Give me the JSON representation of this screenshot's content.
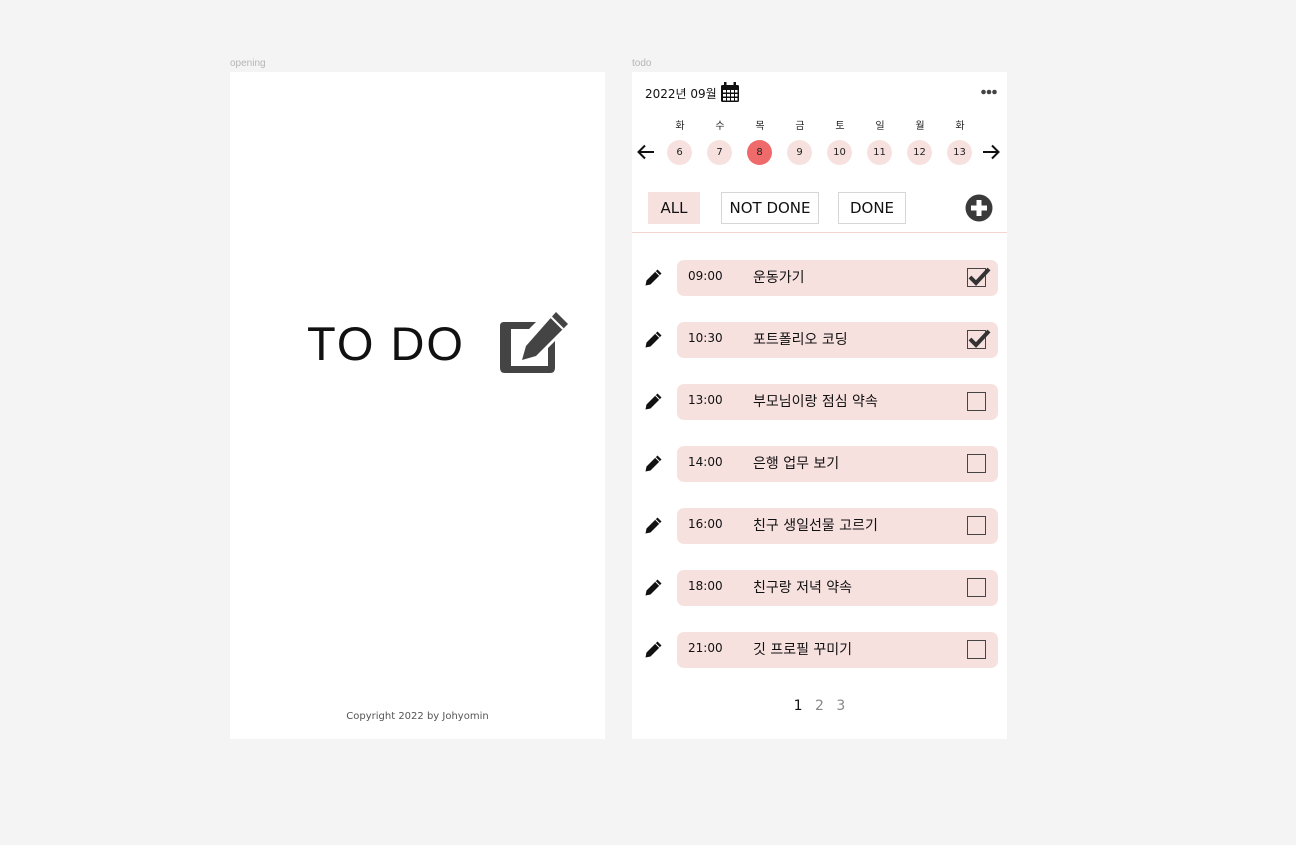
{
  "frames": {
    "opening_label": "opening",
    "todo_label": "todo"
  },
  "opening": {
    "title": "TO DO",
    "title_icon": "edit-square-icon",
    "copyright": "Copyright 2022 by Johyomin"
  },
  "todo": {
    "month": "2022년 09월",
    "calendar_icon": "calendar-icon",
    "more_icon": "more-horizontal-icon",
    "weekdays": [
      "화",
      "수",
      "목",
      "금",
      "토",
      "일",
      "월",
      "화"
    ],
    "dates": [
      "6",
      "7",
      "8",
      "9",
      "10",
      "11",
      "12",
      "13"
    ],
    "selected_date": "8",
    "filters": {
      "all": "ALL",
      "not_done": "NOT DONE",
      "done": "DONE"
    },
    "tasks": [
      {
        "time": "09:00",
        "title": "운동가기",
        "done": true
      },
      {
        "time": "10:30",
        "title": "포트폴리오 코딩",
        "done": true
      },
      {
        "time": "13:00",
        "title": "부모님이랑 점심 약속",
        "done": false
      },
      {
        "time": "14:00",
        "title": "은행 업무 보기",
        "done": false
      },
      {
        "time": "16:00",
        "title": "친구 생일선물 고르기",
        "done": false
      },
      {
        "time": "18:00",
        "title": "친구랑 저녁 약속",
        "done": false
      },
      {
        "time": "21:00",
        "title": "깃 프로필 꾸미기",
        "done": false
      }
    ],
    "pages": [
      "1",
      "2",
      "3"
    ],
    "current_page": "1"
  },
  "colors": {
    "accent_pink": "#f7e1df",
    "selected_red": "#ef6b6b",
    "background": "#f4f4f4"
  }
}
